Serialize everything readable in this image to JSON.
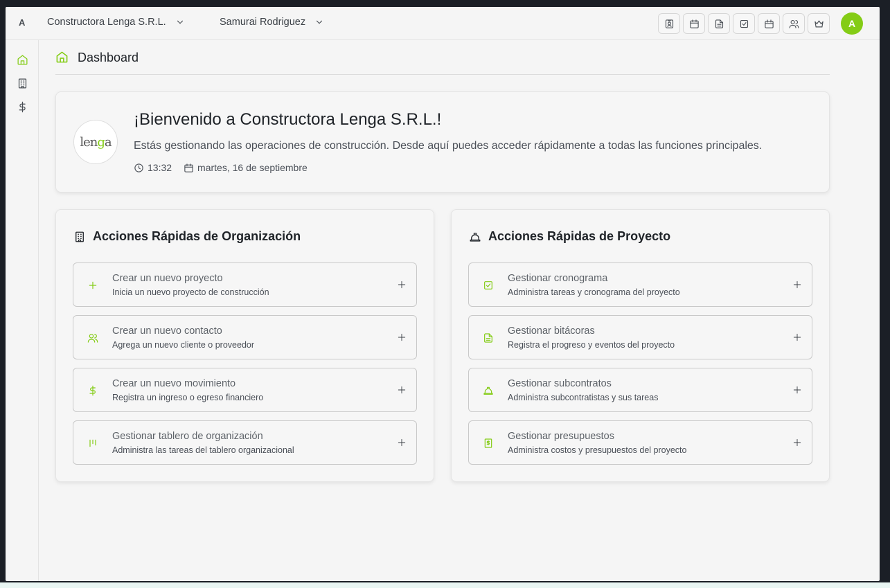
{
  "accent_color": "#84cc16",
  "topbar": {
    "brand_letter": "A",
    "org_selector": "Constructora Lenga S.R.L.",
    "user_selector": "Samurai Rodriguez",
    "tool_icons": [
      "contact-card-icon",
      "calendar-icon",
      "document-icon",
      "checklist-icon",
      "calendar-alt-icon",
      "users-icon",
      "crown-icon"
    ],
    "avatar_letter": "A"
  },
  "sidebar": {
    "items": [
      "home-icon",
      "building-icon",
      "dollar-icon"
    ]
  },
  "page": {
    "title": "Dashboard"
  },
  "welcome": {
    "logo_text_1": "len",
    "logo_text_2": "g",
    "logo_text_3": "a",
    "title": "¡Bienvenido a Constructora Lenga S.R.L.!",
    "description": "Estás gestionando las operaciones de construcción. Desde aquí puedes acceder rápidamente a todas las funciones principales.",
    "time": "13:32",
    "date": "martes, 16 de septiembre"
  },
  "org_actions": {
    "heading": "Acciones Rápidas de Organización",
    "items": [
      {
        "title": "Crear un nuevo proyecto",
        "subtitle": "Inicia un nuevo proyecto de construcción",
        "icon": "plus-icon"
      },
      {
        "title": "Crear un nuevo contacto",
        "subtitle": "Agrega un nuevo cliente o proveedor",
        "icon": "users-icon"
      },
      {
        "title": "Crear un nuevo movimiento",
        "subtitle": "Registra un ingreso o egreso financiero",
        "icon": "dollar-icon"
      },
      {
        "title": "Gestionar tablero de organización",
        "subtitle": "Administra las tareas del tablero organizacional",
        "icon": "kanban-icon"
      }
    ]
  },
  "project_actions": {
    "heading": "Acciones Rápidas de Proyecto",
    "items": [
      {
        "title": "Gestionar cronograma",
        "subtitle": "Administra tareas y cronograma del proyecto",
        "icon": "checklist-icon"
      },
      {
        "title": "Gestionar bitácoras",
        "subtitle": "Registra el progreso y eventos del proyecto",
        "icon": "document-icon"
      },
      {
        "title": "Gestionar subcontratos",
        "subtitle": "Administra subcontratistas y sus tareas",
        "icon": "hard-hat-icon"
      },
      {
        "title": "Gestionar presupuestos",
        "subtitle": "Administra costos y presupuestos del proyecto",
        "icon": "receipt-icon"
      }
    ]
  }
}
